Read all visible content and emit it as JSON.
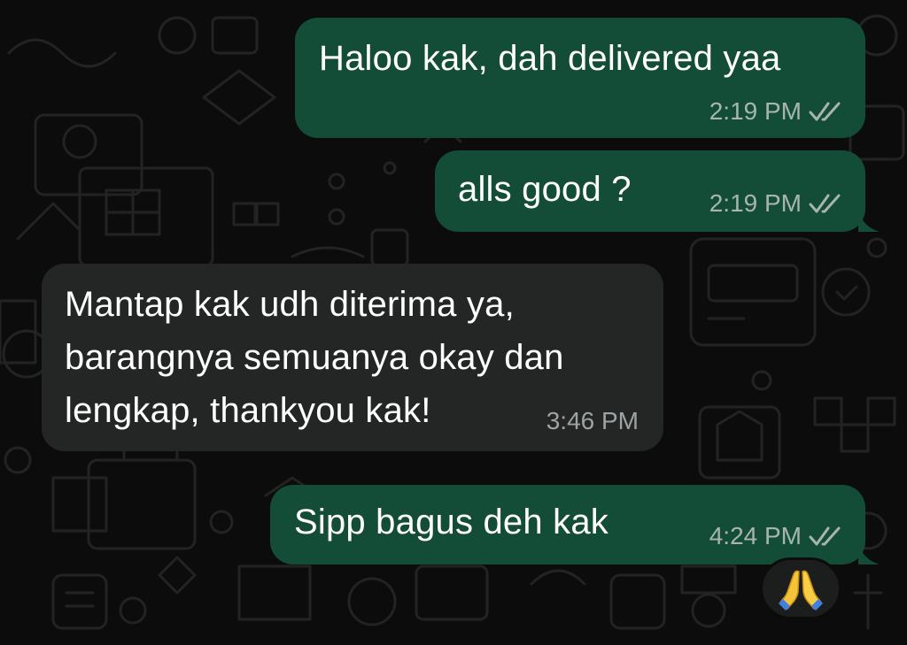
{
  "theme": {
    "outgoing_bubble_color": "#144d37",
    "incoming_bubble_color": "#242626",
    "background_color": "#0c0c0c",
    "read_tick_color": "#a7b5ad"
  },
  "messages": [
    {
      "direction": "outgoing",
      "text": "Haloo kak, dah delivered yaa",
      "time": "2:19 PM",
      "status_icon": "double-check-icon"
    },
    {
      "direction": "outgoing",
      "text": "alls good ?",
      "time": "2:19 PM",
      "status_icon": "double-check-icon"
    },
    {
      "direction": "incoming",
      "text": "Mantap kak udh diterima ya,\nbarangnya semuanya okay dan\nlengkap, thankyou kak!",
      "time": "3:46 PM"
    },
    {
      "direction": "outgoing",
      "text": "Sipp bagus deh kak",
      "time": "4:24 PM",
      "status_icon": "double-check-icon"
    }
  ],
  "reaction": {
    "emoji": "folded-hands-icon"
  }
}
